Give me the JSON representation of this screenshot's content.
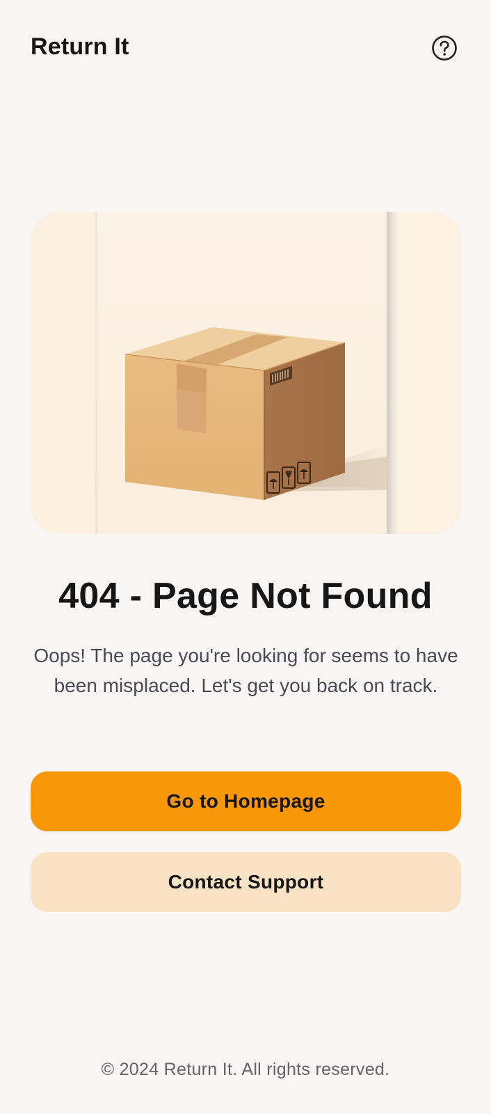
{
  "header": {
    "app_title": "Return It",
    "help_icon": "help-circle-icon"
  },
  "hero": {
    "image": "cardboard-box-illustration"
  },
  "error": {
    "heading": "404 - Page Not Found",
    "message": "Oops! The page you're looking for seems to have been misplaced. Let's get you back on track."
  },
  "actions": {
    "primary_label": "Go to Homepage",
    "secondary_label": "Contact Support"
  },
  "footer": {
    "copyright": "© 2024 Return It. All rights reserved."
  },
  "colors": {
    "background": "#f8f6f4",
    "primary": "#f8970a",
    "secondary": "#f9e3c4",
    "text": "#161616",
    "muted_text": "#4a4a55"
  }
}
